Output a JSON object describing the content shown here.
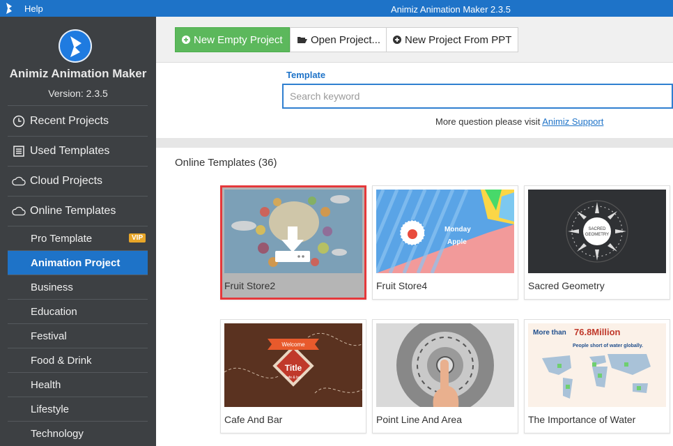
{
  "titlebar": {
    "menu": {
      "help": "Help"
    },
    "window_title": "Animiz Animation Maker 2.3.5"
  },
  "sidebar": {
    "app_name": "Animiz Animation Maker",
    "version": "Version: 2.3.5",
    "main_items": [
      {
        "label": "Recent Projects",
        "icon": "clock-icon"
      },
      {
        "label": "Used Templates",
        "icon": "list-icon"
      },
      {
        "label": "Cloud Projects",
        "icon": "cloud-icon"
      },
      {
        "label": "Online Templates",
        "icon": "cloud-icon"
      }
    ],
    "sub_items": [
      {
        "label": "Pro Template",
        "badge": "VIP"
      },
      {
        "label": "Animation Project",
        "active": true
      },
      {
        "label": "Business"
      },
      {
        "label": "Education"
      },
      {
        "label": "Festival"
      },
      {
        "label": "Food & Drink"
      },
      {
        "label": "Health"
      },
      {
        "label": "Lifestyle"
      },
      {
        "label": "Technology"
      }
    ]
  },
  "toolbar": {
    "new_empty": "New Empty Project",
    "open": "Open Project...",
    "new_from_ppt": "New Project From PPT"
  },
  "search": {
    "label": "Template",
    "placeholder": "Search keyword",
    "value": "",
    "support_text": "More question please visit ",
    "support_link": "Animiz Support"
  },
  "templates": {
    "section_title": "Online Templates (36)",
    "items": [
      {
        "name": "Fruit Store2",
        "selected": true
      },
      {
        "name": "Fruit Store4"
      },
      {
        "name": "Sacred Geometry"
      },
      {
        "name": "Cafe And Bar"
      },
      {
        "name": "Point Line And Area"
      },
      {
        "name": "The Importance of Water"
      }
    ],
    "thumb_text": {
      "fruit_store4_line1": "Monday",
      "fruit_store4_line2": "Apple",
      "sacred_line1": "SACRED",
      "sacred_line2": "GEOMETRY",
      "cafe_banner": "Welcome",
      "cafe_title": "Title",
      "cafe_sub": "cafe & bar",
      "water_prefix": "More than ",
      "water_number": "76.8Million",
      "water_sub": "People short of water globally."
    }
  },
  "colors": {
    "accent": "#1e73c8",
    "sidebar_bg": "#3d4043",
    "primary_button": "#5cb85c",
    "selection": "#e5383b",
    "vip_badge": "#e8a628"
  }
}
